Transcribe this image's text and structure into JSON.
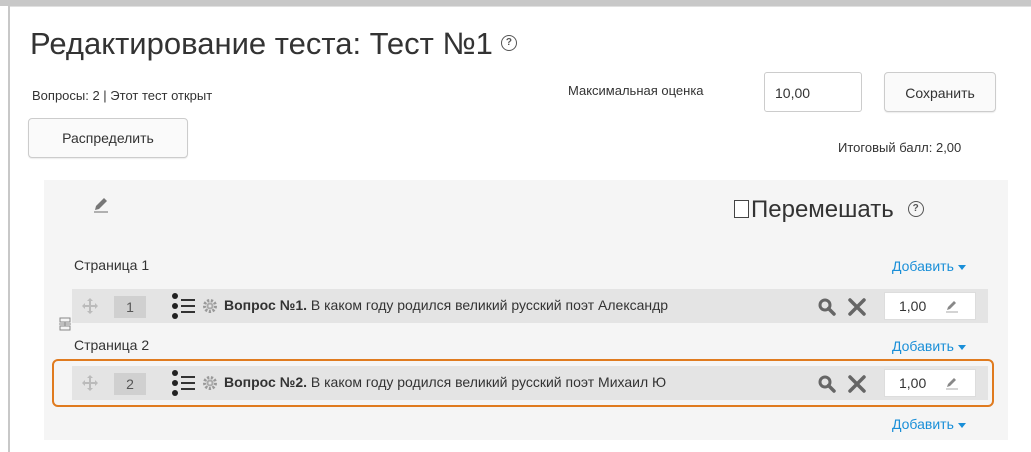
{
  "header": {
    "title": "Редактирование теста: Тест №1",
    "help_glyph": "?",
    "info": "Вопросы: 2 | Этот тест открыт",
    "max_grade_label": "Максимальная оценка",
    "max_grade_value": "10,00",
    "save_label": "Сохранить",
    "repaginate_label": "Распределить",
    "total_marks": "Итоговый балл: 2,00"
  },
  "section": {
    "shuffle_label": "Перемешать"
  },
  "pages": [
    {
      "label": "Страница 1",
      "add_label": "Добавить",
      "questions": [
        {
          "slot": "1",
          "name": "Вопрос №1.",
          "text": " В каком году родился великий русский поэт Александр",
          "mark": "1,00"
        }
      ]
    },
    {
      "label": "Страница 2",
      "add_label": "Добавить",
      "questions": [
        {
          "slot": "2",
          "name": "Вопрос №2.",
          "text": " В каком году родился великий русский поэт Михаил Ю",
          "mark": "1,00"
        }
      ]
    }
  ],
  "footer_add_label": "Добавить",
  "colors": {
    "link": "#1a8fd8",
    "highlight": "#e07b1f",
    "section_bg": "#f5f5f5",
    "row_bg": "#e4e4e4"
  },
  "icons": [
    "help-icon",
    "edit-pencil-icon",
    "move-icon",
    "question-type-icon",
    "gear-icon",
    "preview-icon",
    "delete-icon",
    "split-page-icon"
  ]
}
